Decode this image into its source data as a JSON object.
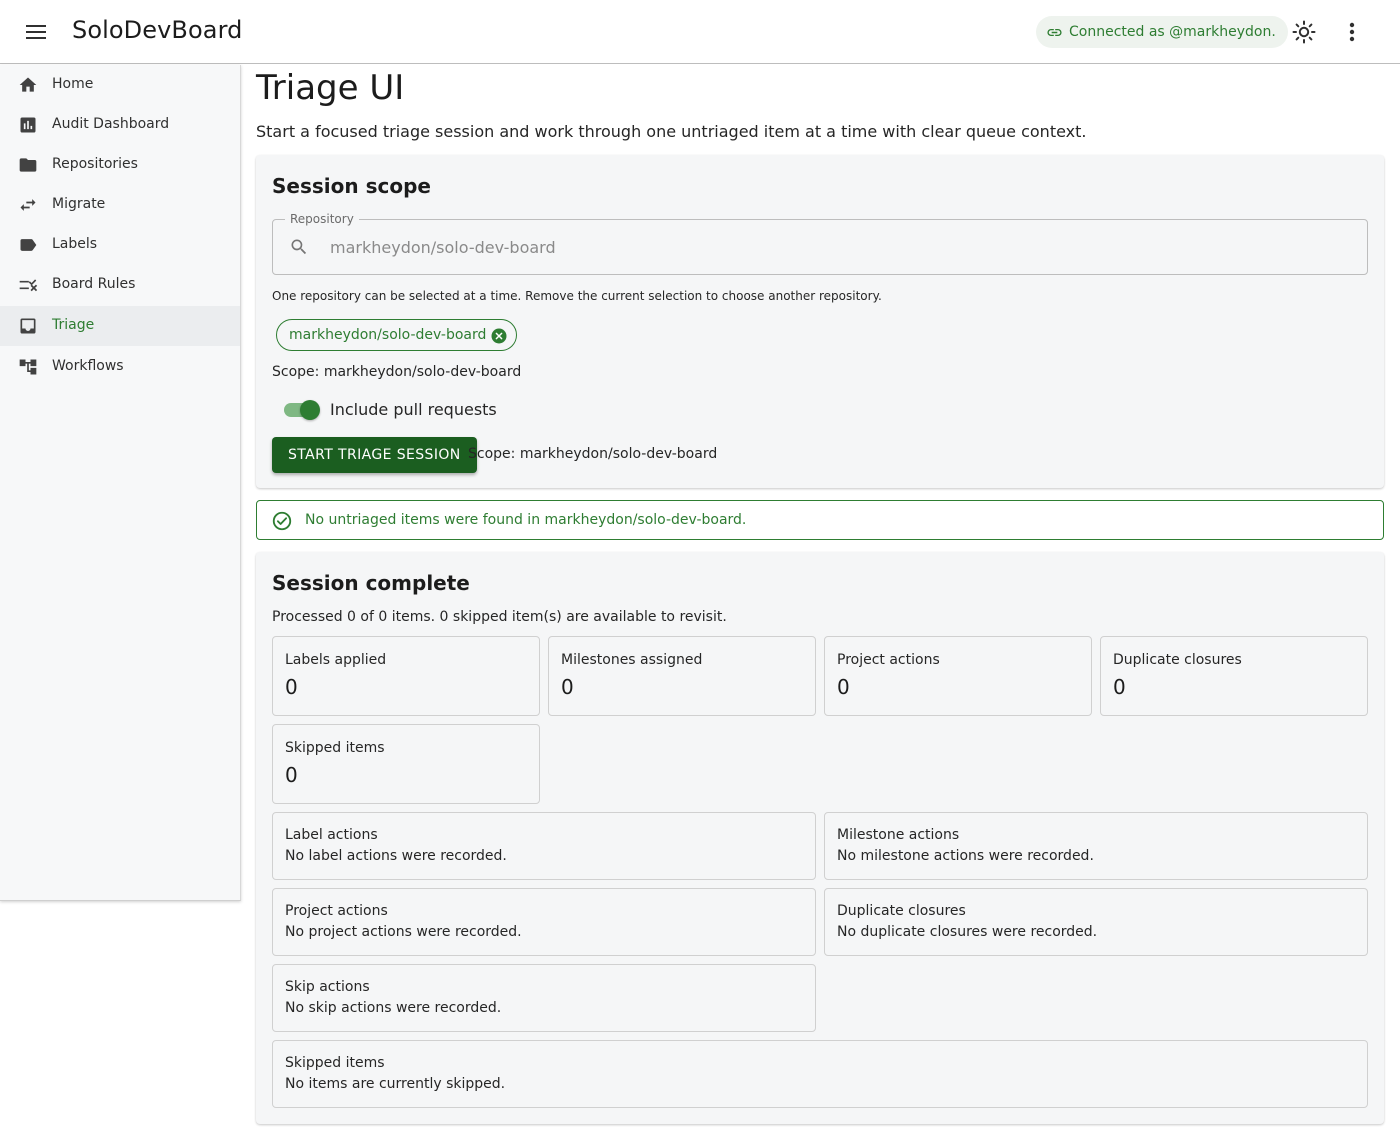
{
  "app": {
    "title": "SoloDevBoard",
    "connection_label": "Connected as @markheydon.",
    "accent_color": "#2e7d32",
    "primary_button_color": "#1b5e20"
  },
  "nav": {
    "items": [
      {
        "label": "Home",
        "icon": "home-icon"
      },
      {
        "label": "Audit Dashboard",
        "icon": "chart-icon"
      },
      {
        "label": "Repositories",
        "icon": "folder-icon"
      },
      {
        "label": "Migrate",
        "icon": "swap-icon"
      },
      {
        "label": "Labels",
        "icon": "label-icon"
      },
      {
        "label": "Board Rules",
        "icon": "rule-icon"
      },
      {
        "label": "Triage",
        "icon": "inbox-icon",
        "active": true
      },
      {
        "label": "Workflows",
        "icon": "workflow-icon"
      }
    ]
  },
  "page": {
    "title": "Triage UI",
    "description": "Start a focused triage session and work through one untriaged item at a time with clear queue context."
  },
  "scope": {
    "title": "Session scope",
    "repo_field_label": "Repository",
    "repo_placeholder": "markheydon/solo-dev-board",
    "helper": "One repository can be selected at a time. Remove the current selection to choose another repository.",
    "chip_label": "markheydon/solo-dev-board",
    "scope_text": "Scope: markheydon/solo-dev-board",
    "include_prs_label": "Include pull requests",
    "include_prs_on": true,
    "start_button": "START TRIAGE SESSION",
    "button_scope_text": "Scope: markheydon/solo-dev-board"
  },
  "alert": {
    "text": "No untriaged items were found in markheydon/solo-dev-board."
  },
  "summary": {
    "title": "Session complete",
    "processed": "Processed 0 of 0 items. 0 skipped item(s) are available to revisit.",
    "stats": [
      {
        "label": "Labels applied",
        "value": "0"
      },
      {
        "label": "Milestones assigned",
        "value": "0"
      },
      {
        "label": "Project actions",
        "value": "0"
      },
      {
        "label": "Duplicate closures",
        "value": "0"
      },
      {
        "label": "Skipped items",
        "value": "0"
      }
    ],
    "actions": [
      {
        "label": "Label actions",
        "text": "No label actions were recorded."
      },
      {
        "label": "Milestone actions",
        "text": "No milestone actions were recorded."
      },
      {
        "label": "Project actions",
        "text": "No project actions were recorded."
      },
      {
        "label": "Duplicate closures",
        "text": "No duplicate closures were recorded."
      },
      {
        "label": "Skip actions",
        "text": "No skip actions were recorded."
      },
      {
        "label": "Skipped items",
        "text": "No items are currently skipped."
      }
    ]
  }
}
